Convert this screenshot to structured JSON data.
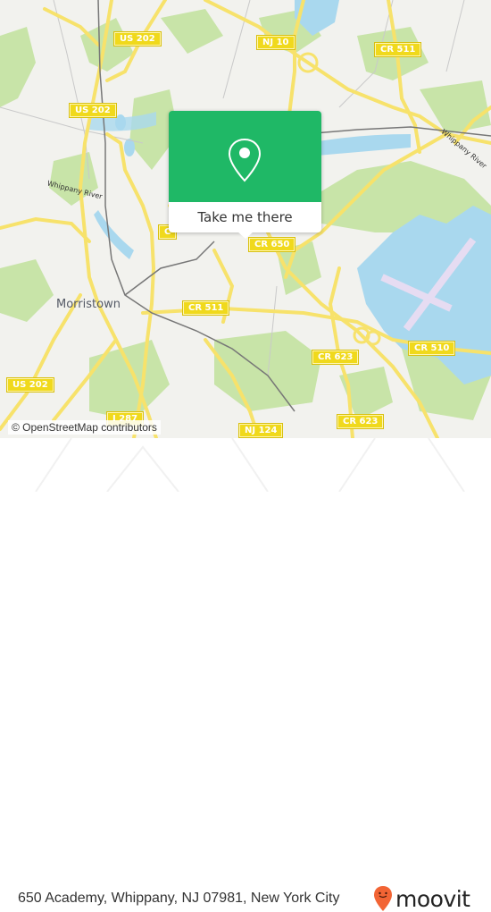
{
  "map": {
    "colors": {
      "background": "#f2f2ee",
      "forest": "#c8e4a8",
      "water": "#a9d8ee",
      "road": "#f7e26b",
      "rail": "#777777",
      "runway": "#e6dcf2"
    },
    "shields": [
      {
        "label": "US 202"
      },
      {
        "label": "US 202"
      },
      {
        "label": "NJ 10"
      },
      {
        "label": "CR 511"
      },
      {
        "label": "CR 650"
      },
      {
        "label": "CR 511"
      },
      {
        "label": "CR 623"
      },
      {
        "label": "CR 510"
      },
      {
        "label": "US 202"
      },
      {
        "label": "I 287"
      },
      {
        "label": "NJ 124"
      },
      {
        "label": "CR 623"
      },
      {
        "label": "C"
      }
    ],
    "places": [
      {
        "label": "Morristown"
      }
    ],
    "rivers": [
      {
        "label": "Whippany River"
      },
      {
        "label": "Whippany River"
      }
    ],
    "attribution": "© OpenStreetMap contributors"
  },
  "popup": {
    "icon": "location-pin-icon",
    "accent": "#1fb866",
    "action_label": "Take me there"
  },
  "footer": {
    "address": "650 Academy, Whippany, NJ 07981, New York City",
    "brand": "moovit",
    "brand_color": "#f26434"
  }
}
